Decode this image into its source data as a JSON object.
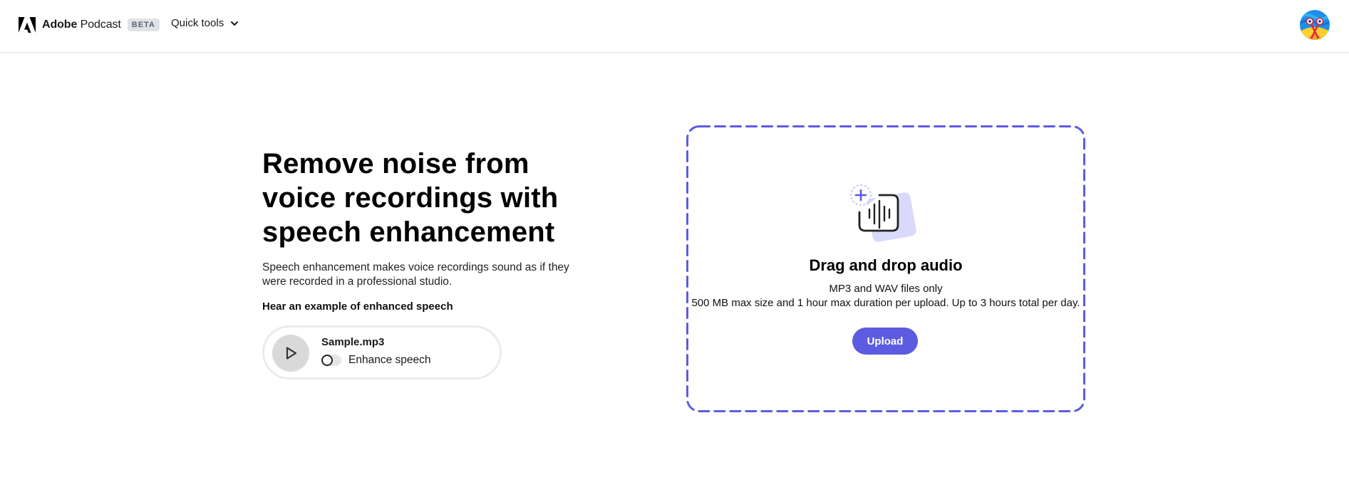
{
  "header": {
    "brand_bold": "Adobe",
    "brand_rest": " Podcast",
    "beta_badge": "BETA",
    "quick_tools_label": "Quick tools",
    "icons": {
      "logo": "adobe-logo-icon",
      "dropdown": "chevron-down-icon",
      "avatar": "user-avatar"
    }
  },
  "hero": {
    "title": "Remove noise from voice recordings with speech enhancement",
    "description": "Speech enhancement makes voice recordings sound as if they were recorded in a professional studio.",
    "example_label": "Hear an example of enhanced speech"
  },
  "sample_player": {
    "file_name": "Sample.mp3",
    "toggle_label": "Enhance speech",
    "toggle_on": false,
    "play_icon": "play-icon"
  },
  "dropzone": {
    "title": "Drag and drop audio",
    "formats": "MP3 and WAV files only",
    "limits": "500 MB max size and 1 hour max duration per upload. Up to 3 hours total per day.",
    "upload_label": "Upload",
    "icon": "add-audio-icon"
  },
  "colors": {
    "accent": "#5c5ce0",
    "accent_light": "#d9d9fb",
    "badge_bg": "#dfe2e6",
    "play_bg": "#d9d9d9"
  }
}
